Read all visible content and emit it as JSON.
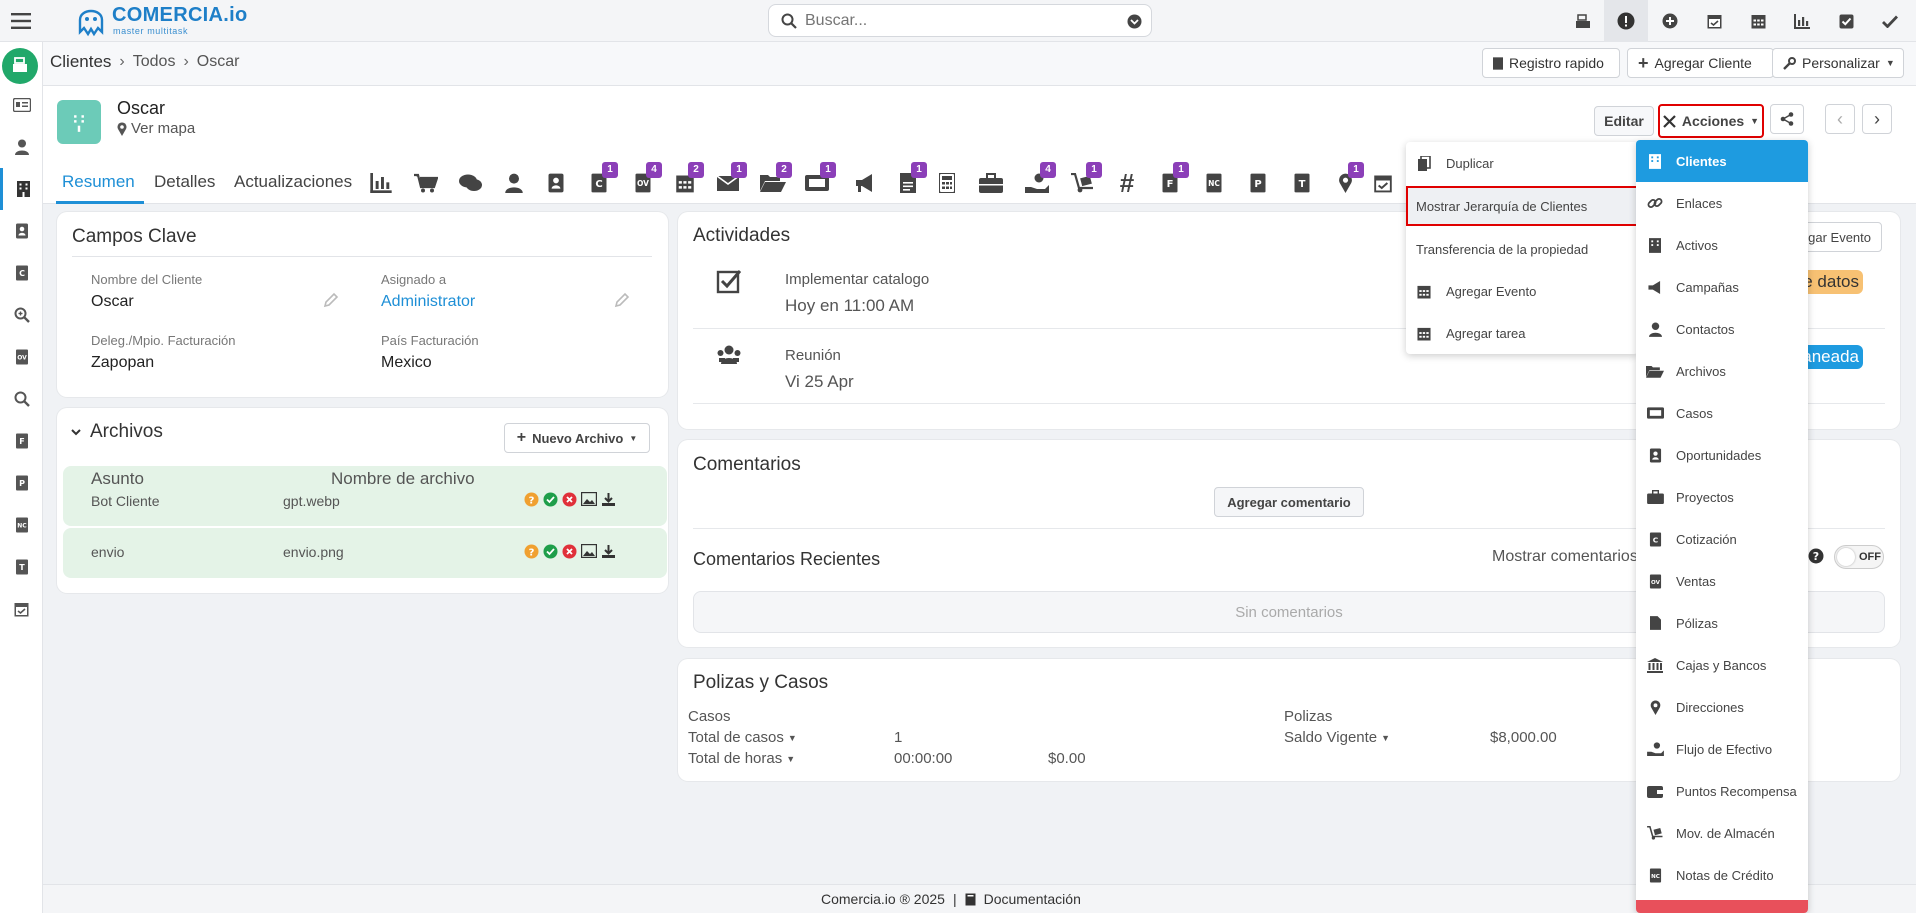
{
  "app": {
    "logo_text": "COMERCIA.io",
    "logo_sub": "master multitask"
  },
  "search": {
    "placeholder": "Buscar..."
  },
  "topbar_icons": [
    "cash-register-icon",
    "alert-icon",
    "plus-circle-icon",
    "calendar-check-icon",
    "calendar-icon",
    "bar-chart-icon",
    "checkbox-icon",
    "check-icon"
  ],
  "breadcrumb": {
    "root": "Clientes",
    "level1": "Todos",
    "current": "Oscar"
  },
  "crumb_buttons": {
    "quick": "Registro rapido",
    "add": "Agregar Cliente",
    "custom": "Personalizar"
  },
  "record": {
    "name": "Oscar",
    "map_link": "Ver mapa",
    "edit": "Editar",
    "actions": "Acciones"
  },
  "tabs": {
    "summary": "Resumen",
    "details": "Detalles",
    "updates": "Actualizaciones"
  },
  "tab_badges": [
    "1",
    "4",
    "2",
    "1",
    "2",
    "1",
    "1",
    "4",
    "1",
    "1",
    "1"
  ],
  "key_fields": {
    "title": "Campos Clave",
    "client_name_label": "Nombre del Cliente",
    "client_name": "Oscar",
    "assigned_label": "Asignado a",
    "assigned": "Administrator",
    "municipality_label": "Deleg./Mpio. Facturación",
    "municipality": "Zapopan",
    "country_label": "País Facturación",
    "country": "Mexico"
  },
  "files": {
    "title": "Archivos",
    "new_button": "Nuevo Archivo",
    "col_subject": "Asunto",
    "col_filename": "Nombre de archivo",
    "rows": [
      {
        "subject": "Bot Cliente",
        "filename": "gpt.webp"
      },
      {
        "subject": "envio",
        "filename": "envio.png"
      }
    ]
  },
  "activities": {
    "title": "Actividades",
    "add_event": "gar Evento",
    "items": [
      {
        "title": "Implementar catalogo",
        "time": "Hoy en 11:00 AM",
        "badge": "e datos"
      },
      {
        "title": "Reunión",
        "time": "Vi 25 Apr",
        "badge": "aneada"
      }
    ]
  },
  "comments": {
    "title": "Comentarios",
    "add_button": "Agregar comentario",
    "recent_title": "Comentarios Recientes",
    "show_label": "Mostrar comentarios c",
    "toggle": "OFF",
    "empty": "Sin comentarios"
  },
  "policies": {
    "title": "Polizas y Casos",
    "cases_label": "Casos",
    "total_cases_label": "Total de casos",
    "total_cases": "1",
    "total_hours_label": "Total de horas",
    "total_hours": "00:00:00",
    "amount": "$0.00",
    "policies_label": "Polizas",
    "balance_label": "Saldo Vigente",
    "balance": "$8,000.00"
  },
  "actions_menu": [
    "Duplicar",
    "Mostrar Jerarquía de Clientes",
    "Transferencia de la propiedad",
    "Agregar Evento",
    "Agregar tarea"
  ],
  "nav_menu": [
    "Clientes",
    "Enlaces",
    "Activos",
    "Campañas",
    "Contactos",
    "Archivos",
    "Casos",
    "Oportunidades",
    "Proyectos",
    "Cotización",
    "Ventas",
    "Pólizas",
    "Cajas y Bancos",
    "Direcciones",
    "Flujo de Efectivo",
    "Puntos Recompensa",
    "Mov. de Almacén",
    "Notas de Crédito"
  ],
  "footer": {
    "copyright": "Comercia.io ® 2025",
    "docs": "Documentación"
  },
  "colors": {
    "accent": "#1e8fd6",
    "highlight": "#e00000",
    "badge": "#8b3fb8",
    "avatar": "#6ccbb8"
  }
}
